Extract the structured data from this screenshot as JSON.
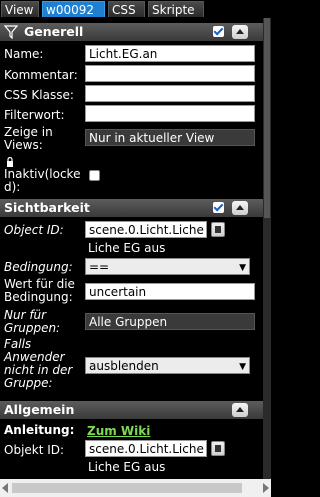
{
  "tabs": [
    {
      "label": "View",
      "active": false
    },
    {
      "label": "w00092",
      "active": true
    },
    {
      "label": "CSS",
      "active": false
    },
    {
      "label": "Skripte",
      "active": false
    }
  ],
  "general": {
    "title": "Generell",
    "name_label": "Name:",
    "name_value": "Licht.EG.an",
    "comment_label": "Kommentar:",
    "css_class_label": "CSS Klasse:",
    "filter_label": "Filterwort:",
    "views_label_line1": "Zeige in",
    "views_label_line2": "Views:",
    "views_value": "Nur in aktueller View",
    "inactive_label_line1": "Inaktiv(locke",
    "inactive_label_line2": "d):"
  },
  "visibility": {
    "title": "Sichtbarkeit",
    "object_id_label": "Object ID:",
    "object_id_value": "scene.0.Licht.Liche",
    "object_id_desc": "Liche EG aus",
    "condition_label": "Bedingung:",
    "condition_value": "==",
    "value_label_line1": "Wert für die",
    "value_label_line2": "Bedingung:",
    "value_value": "uncertain",
    "groups_label_line1": "Nur für",
    "groups_label_line2": "Gruppen:",
    "groups_value": "Alle Gruppen",
    "fallback_label_line1": "Falls",
    "fallback_label_line2": "Anwender",
    "fallback_label_line3": "nicht in der",
    "fallback_label_line4": "Gruppe:",
    "fallback_value": "ausblenden"
  },
  "common": {
    "title": "Allgemein",
    "manual_label": "Anleitung:",
    "wiki_link": "Zum Wiki",
    "object_id_label": "Objekt ID:",
    "object_id_value": "scene.0.Licht.Liche",
    "object_id_desc": "Liche EG aus"
  },
  "colors": {
    "background": "#000000",
    "header": "#4a4a4a",
    "active_tab": "#1f7fd0",
    "link": "#7ed957"
  }
}
